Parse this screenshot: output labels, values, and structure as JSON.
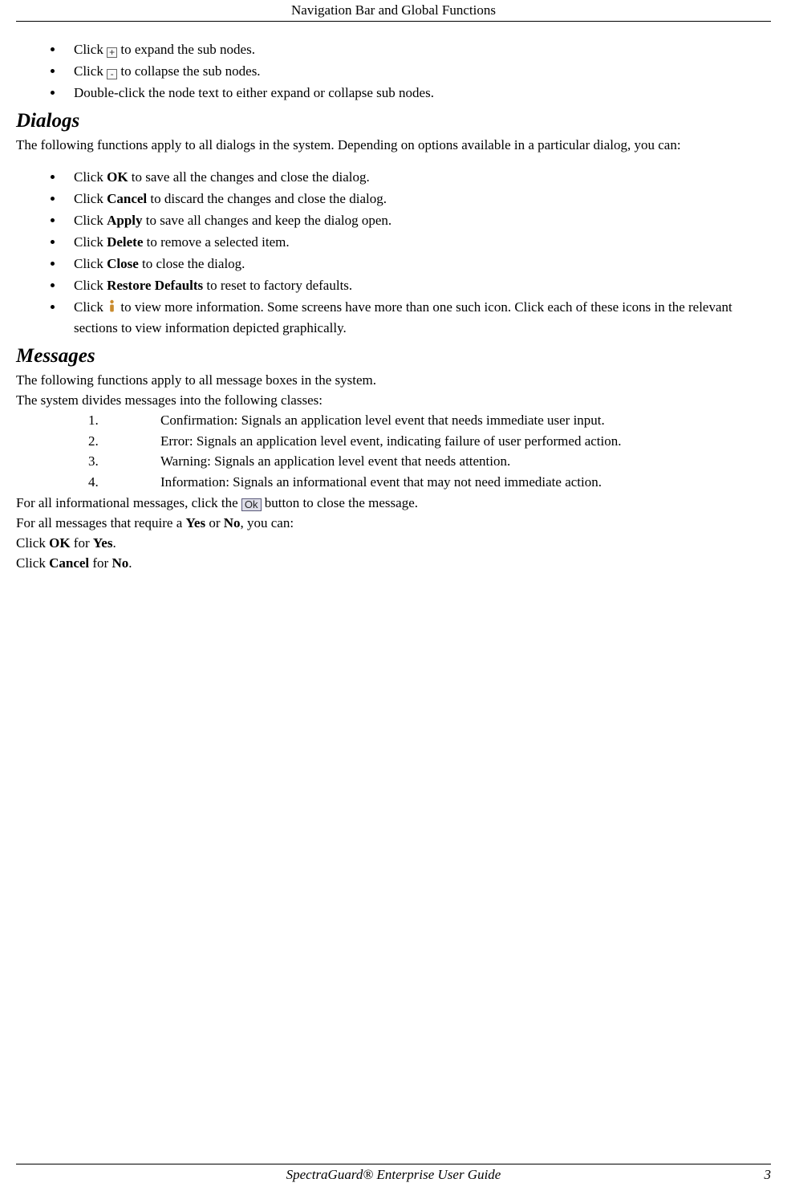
{
  "header": {
    "title": "Navigation Bar and Global Functions"
  },
  "tree": {
    "expand": {
      "pre": "Click ",
      "post": " to expand the sub nodes."
    },
    "collapse": {
      "pre": "Click ",
      "post": " to collapse the sub nodes."
    },
    "dblclick": " Double-click the node text to either expand or collapse sub nodes."
  },
  "dialogs": {
    "heading": "Dialogs",
    "intro": "The following functions apply to all dialogs in the system. Depending on options available in a particular dialog, you can:",
    "items": [
      {
        "pre": "Click ",
        "bold": "OK",
        "post": " to save all the changes and close the dialog."
      },
      {
        "pre": "Click ",
        "bold": "Cancel",
        "post": " to discard the changes and close the dialog."
      },
      {
        "pre": "Click ",
        "bold": "Apply",
        "post": " to save all changes and keep the dialog open."
      },
      {
        "pre": "Click ",
        "bold": "Delete",
        "post": " to remove a selected item."
      },
      {
        "pre": "Click ",
        "bold": "Close",
        "post": " to close the dialog."
      },
      {
        "pre": "Click ",
        "bold": "Restore Defaults",
        "post": " to reset to factory defaults."
      }
    ],
    "info_item": {
      "pre": "Click  ",
      "post": "  to view more information. Some screens have more than one such icon. Click each of these icons in the relevant sections to view information depicted graphically."
    }
  },
  "messages": {
    "heading": "Messages",
    "intro1": "The following functions apply to all message boxes in the system.",
    "intro2": "The system divides messages into the following classes:",
    "classes": [
      "Confirmation: Signals an application level event that needs immediate user input.",
      "Error: Signals an application level event, indicating failure of user performed action.",
      "Warning: Signals an application level event that needs attention.",
      "Information: Signals an informational event that may not need immediate action."
    ],
    "info_close": {
      "pre": "For all informational messages, click the ",
      "ok_label": "Ok",
      "post": " button to close the message."
    },
    "yesno": {
      "pre": "For all messages that require a ",
      "yes": "Yes",
      "mid": " or ",
      "no": "No",
      "post": ", you can:"
    },
    "click_ok": {
      "pre": "Click ",
      "b1": "OK",
      "mid": " for ",
      "b2": "Yes",
      "post": "."
    },
    "click_cancel": {
      "pre": "Click ",
      "b1": "Cancel",
      "mid": " for ",
      "b2": "No",
      "post": "."
    }
  },
  "footer": {
    "guide": "SpectraGuard®  Enterprise User Guide",
    "page": "3"
  }
}
